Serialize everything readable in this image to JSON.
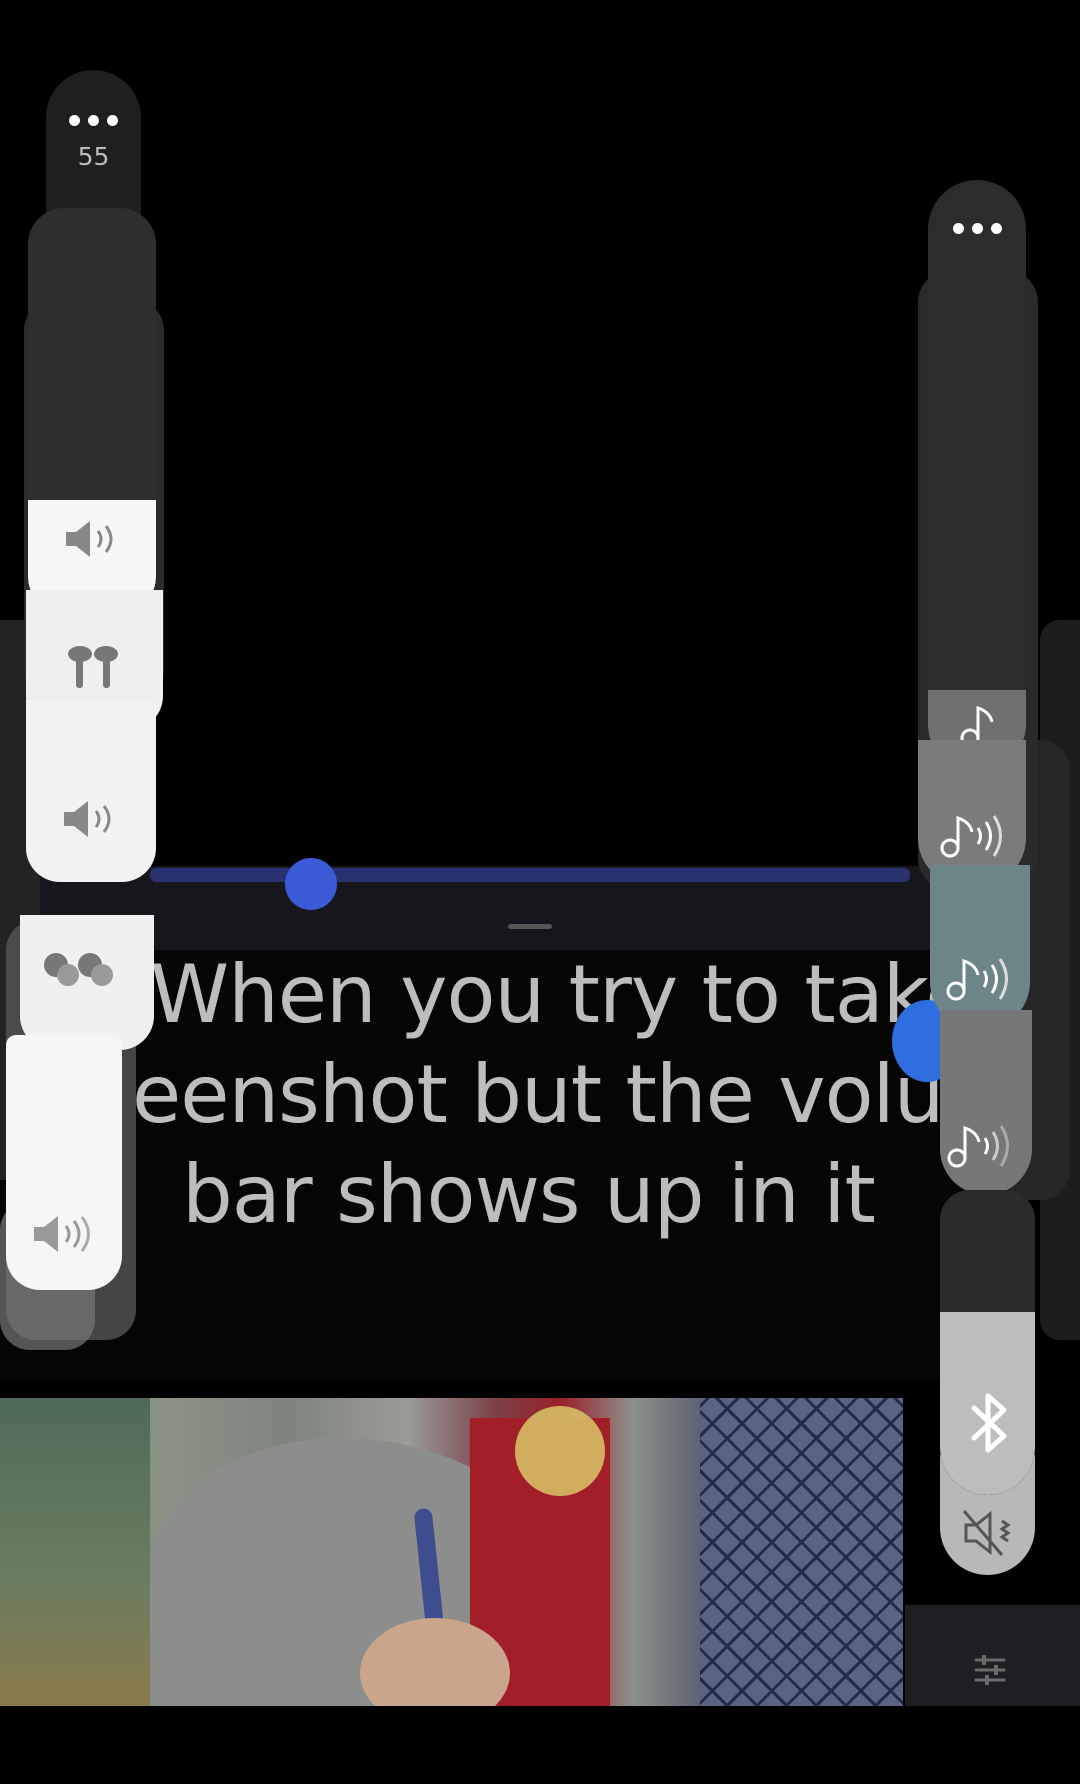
{
  "meme": {
    "caption_lines": [
      "When you try to take a",
      "eenshot but the volum",
      "bar shows up in it"
    ]
  },
  "volume_left": {
    "level": "55",
    "fill_fraction": 0.28,
    "items": [
      {
        "icon": "speaker-icon"
      },
      {
        "icon": "earbuds-icon"
      },
      {
        "icon": "speaker-icon"
      },
      {
        "icon": "earbuds-icon"
      },
      {
        "icon": "speaker-icon"
      }
    ]
  },
  "volume_right": {
    "fill_fraction": 0.12,
    "items": [
      {
        "icon": "music-note-icon"
      },
      {
        "icon": "music-note-sound-icon"
      },
      {
        "icon": "music-note-sound-icon"
      },
      {
        "icon": "music-note-sound-icon"
      }
    ],
    "bluetooth_fill_fraction": 0.6,
    "bluetooth_icon": "bluetooth-icon",
    "mute_icon": "vibrate-mute-icon",
    "settings_icon": "equalizer-icon"
  },
  "colors": {
    "video_seek_thumb": "#3a5ad6",
    "accent_blue": "#2f6ee0"
  }
}
